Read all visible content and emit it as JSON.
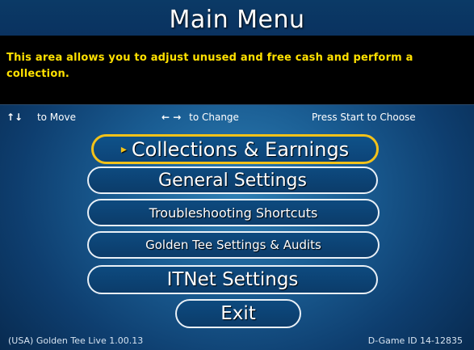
{
  "title": "Main Menu",
  "description": "This area allows you to adjust unused and free cash and perform a collection.",
  "help": {
    "move_icon": "↑↓",
    "move_label": "to Move",
    "change_icon": "← →",
    "change_label": "to Change",
    "choose_label": "Press Start to Choose"
  },
  "menu": [
    {
      "label": "Collections & Earnings",
      "selected": true
    },
    {
      "label": "General Settings",
      "selected": false
    },
    {
      "label": "Troubleshooting Shortcuts",
      "selected": false
    },
    {
      "label": "Golden Tee Settings & Audits",
      "selected": false
    },
    {
      "label": "ITNet Settings",
      "selected": false
    },
    {
      "label": "Exit",
      "selected": false
    }
  ],
  "selection_marker": "▸",
  "footer": {
    "left": "(USA) Golden Tee Live 1.00.13",
    "right": "D-Game ID 14-12835"
  },
  "colors": {
    "selected_border": "#f3c21a",
    "description_text": "#ffe100",
    "title_bar": "#0b3a66"
  }
}
